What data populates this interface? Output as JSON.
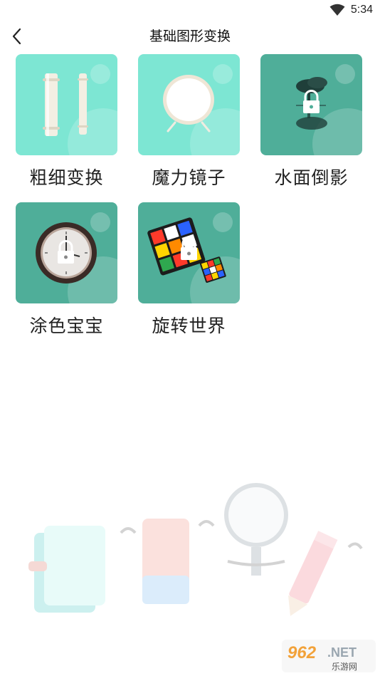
{
  "status_bar": {
    "time": "5:34"
  },
  "header": {
    "title": "基础图形变换"
  },
  "items": [
    {
      "label": "粗细变换",
      "icon": "rolling-pins-icon",
      "locked": false
    },
    {
      "label": "魔力镜子",
      "icon": "mirror-icon",
      "locked": false
    },
    {
      "label": "水面倒影",
      "icon": "tree-reflection-icon",
      "locked": true
    },
    {
      "label": "涂色宝宝",
      "icon": "clock-icon",
      "locked": true
    },
    {
      "label": "旋转世界",
      "icon": "rubiks-cube-icon",
      "locked": true
    }
  ],
  "colors": {
    "unlocked_tile": "#7de6d3",
    "locked_tile": "#4fae99"
  },
  "watermark": {
    "main": "962",
    "suffix": ".NET",
    "sub": "乐游网"
  }
}
